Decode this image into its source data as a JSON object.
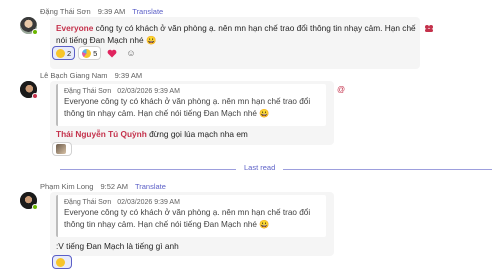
{
  "messages": [
    {
      "author": "Đặng Thái Sơn",
      "time": "9:39 AM",
      "translate": "Translate",
      "mention": "Everyone",
      "text": " công ty có khách ở văn phòng ạ. nên mn hạn chế trao đổi thông tin nhạy cảm. Hạn chế nói tiếng Đan Mạch nhé 😀",
      "reactions": [
        {
          "icon": "grinning-face-emoji",
          "count": "2"
        },
        {
          "icon": "party-face-emoji",
          "count": "5"
        },
        {
          "icon": "heart-emoji",
          "count": ""
        }
      ]
    },
    {
      "author": "Lê Bạch Giang Nam",
      "time": "9:39 AM",
      "quote_author": "Đặng Thái Sơn",
      "quote_time": "02/03/2026 9:39 AM",
      "quote_text": "Everyone công ty có khách ở văn phòng ạ. nên mn hạn chế trao đổi thông tin nhạy cảm. Hạn chế nói tiếng Đan Mạch nhé 😀",
      "mention": "Thái Nguyễn Tú Quỳnh",
      "text": " đừng gọi lúa mạch nha em",
      "reactions": [
        {
          "icon": "avatar-reaction",
          "count": ""
        }
      ],
      "side_icon": "@"
    },
    {
      "author": "Phạm Kim Long",
      "time": "9:52 AM",
      "translate": "Translate",
      "quote_author": "Đặng Thái Sơn",
      "quote_time": "02/03/2026 9:39 AM",
      "quote_text": "Everyone công ty có khách ở văn phòng ạ. nên mn hạn chế trao đổi thông tin nhạy cảm. Hạn chế nói tiếng Đan Mạch nhé 😀",
      "text": ":V tiếng Đan Mạch là tiếng gì anh",
      "reactions": [
        {
          "icon": "grinning-face-emoji",
          "count": ""
        }
      ]
    }
  ],
  "divider": "Last read",
  "colors": {
    "accent": "#5b5fc7",
    "mention": "#c4314b",
    "bubble": "#f5f5f5"
  }
}
